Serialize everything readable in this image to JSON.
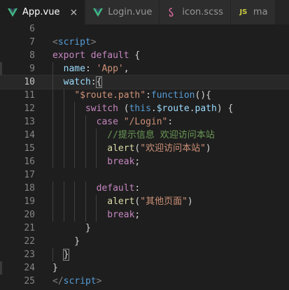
{
  "tabs": [
    {
      "label": "App.vue",
      "icon": "vue-icon",
      "active": true,
      "close": "×"
    },
    {
      "label": "Login.vue",
      "icon": "vue-icon",
      "active": false
    },
    {
      "label": "icon.scss",
      "icon": "scss-icon",
      "active": false
    },
    {
      "label": "ma",
      "icon": "js-icon",
      "icon_text": "JS",
      "active": false
    }
  ],
  "editor": {
    "current_line": 10,
    "lines": [
      {
        "n": "6",
        "tokens": []
      },
      {
        "n": "7",
        "tokens": [
          {
            "c": "t",
            "v": "<"
          },
          {
            "c": "k",
            "v": "script"
          },
          {
            "c": "t",
            "v": ">"
          }
        ]
      },
      {
        "n": "8",
        "tokens": [
          {
            "c": "kc",
            "v": "export"
          },
          {
            "c": "",
            "v": " "
          },
          {
            "c": "kc",
            "v": "default"
          },
          {
            "c": "",
            "v": " {"
          }
        ]
      },
      {
        "n": "9",
        "tokens": [
          {
            "c": "",
            "v": "  "
          },
          {
            "c": "p",
            "v": "name"
          },
          {
            "c": "",
            "v": ": "
          },
          {
            "c": "s",
            "v": "'App'"
          },
          {
            "c": "",
            "v": ","
          }
        ]
      },
      {
        "n": "10",
        "tokens": [
          {
            "c": "",
            "v": "  "
          },
          {
            "c": "p",
            "v": "watch"
          },
          {
            "c": "",
            "v": ":"
          },
          {
            "c": "box",
            "v": "{"
          }
        ]
      },
      {
        "n": "11",
        "tokens": [
          {
            "c": "",
            "v": "    "
          },
          {
            "c": "s",
            "v": "\"$route.path\""
          },
          {
            "c": "",
            "v": ":"
          },
          {
            "c": "k",
            "v": "function"
          },
          {
            "c": "",
            "v": "(){"
          }
        ]
      },
      {
        "n": "12",
        "tokens": [
          {
            "c": "",
            "v": "      "
          },
          {
            "c": "kc",
            "v": "switch"
          },
          {
            "c": "",
            "v": " ("
          },
          {
            "c": "k",
            "v": "this"
          },
          {
            "c": "",
            "v": "."
          },
          {
            "c": "p",
            "v": "$route"
          },
          {
            "c": "",
            "v": "."
          },
          {
            "c": "p",
            "v": "path"
          },
          {
            "c": "",
            "v": ") {"
          }
        ]
      },
      {
        "n": "13",
        "tokens": [
          {
            "c": "",
            "v": "        "
          },
          {
            "c": "kc",
            "v": "case"
          },
          {
            "c": "",
            "v": " "
          },
          {
            "c": "s",
            "v": "\"/Login\""
          },
          {
            "c": "",
            "v": ":"
          }
        ]
      },
      {
        "n": "14",
        "tokens": [
          {
            "c": "",
            "v": "          "
          },
          {
            "c": "c",
            "v": "//提示信息 欢迎访问本站"
          }
        ]
      },
      {
        "n": "15",
        "tokens": [
          {
            "c": "",
            "v": "          "
          },
          {
            "c": "f",
            "v": "alert"
          },
          {
            "c": "",
            "v": "("
          },
          {
            "c": "s",
            "v": "\"欢迎访问本站\""
          },
          {
            "c": "",
            "v": ")"
          }
        ]
      },
      {
        "n": "16",
        "tokens": [
          {
            "c": "",
            "v": "          "
          },
          {
            "c": "kc",
            "v": "break"
          },
          {
            "c": "",
            "v": ";"
          }
        ]
      },
      {
        "n": "17",
        "tokens": []
      },
      {
        "n": "18",
        "tokens": [
          {
            "c": "",
            "v": "        "
          },
          {
            "c": "kc",
            "v": "default"
          },
          {
            "c": "",
            "v": ":"
          }
        ]
      },
      {
        "n": "19",
        "tokens": [
          {
            "c": "",
            "v": "          "
          },
          {
            "c": "f",
            "v": "alert"
          },
          {
            "c": "",
            "v": "("
          },
          {
            "c": "s",
            "v": "\"其他页面\""
          },
          {
            "c": "",
            "v": ")"
          }
        ]
      },
      {
        "n": "20",
        "tokens": [
          {
            "c": "",
            "v": "          "
          },
          {
            "c": "kc",
            "v": "break"
          },
          {
            "c": "",
            "v": ";"
          }
        ]
      },
      {
        "n": "21",
        "tokens": [
          {
            "c": "",
            "v": "      }"
          }
        ]
      },
      {
        "n": "22",
        "tokens": [
          {
            "c": "",
            "v": "    }"
          }
        ]
      },
      {
        "n": "23",
        "tokens": [
          {
            "c": "",
            "v": "  "
          },
          {
            "c": "box",
            "v": "}"
          }
        ]
      },
      {
        "n": "24",
        "tokens": [
          {
            "c": "",
            "v": "}"
          }
        ]
      },
      {
        "n": "25",
        "tokens": [
          {
            "c": "t",
            "v": "</"
          },
          {
            "c": "k",
            "v": "script"
          },
          {
            "c": "t",
            "v": ">"
          }
        ]
      }
    ]
  }
}
